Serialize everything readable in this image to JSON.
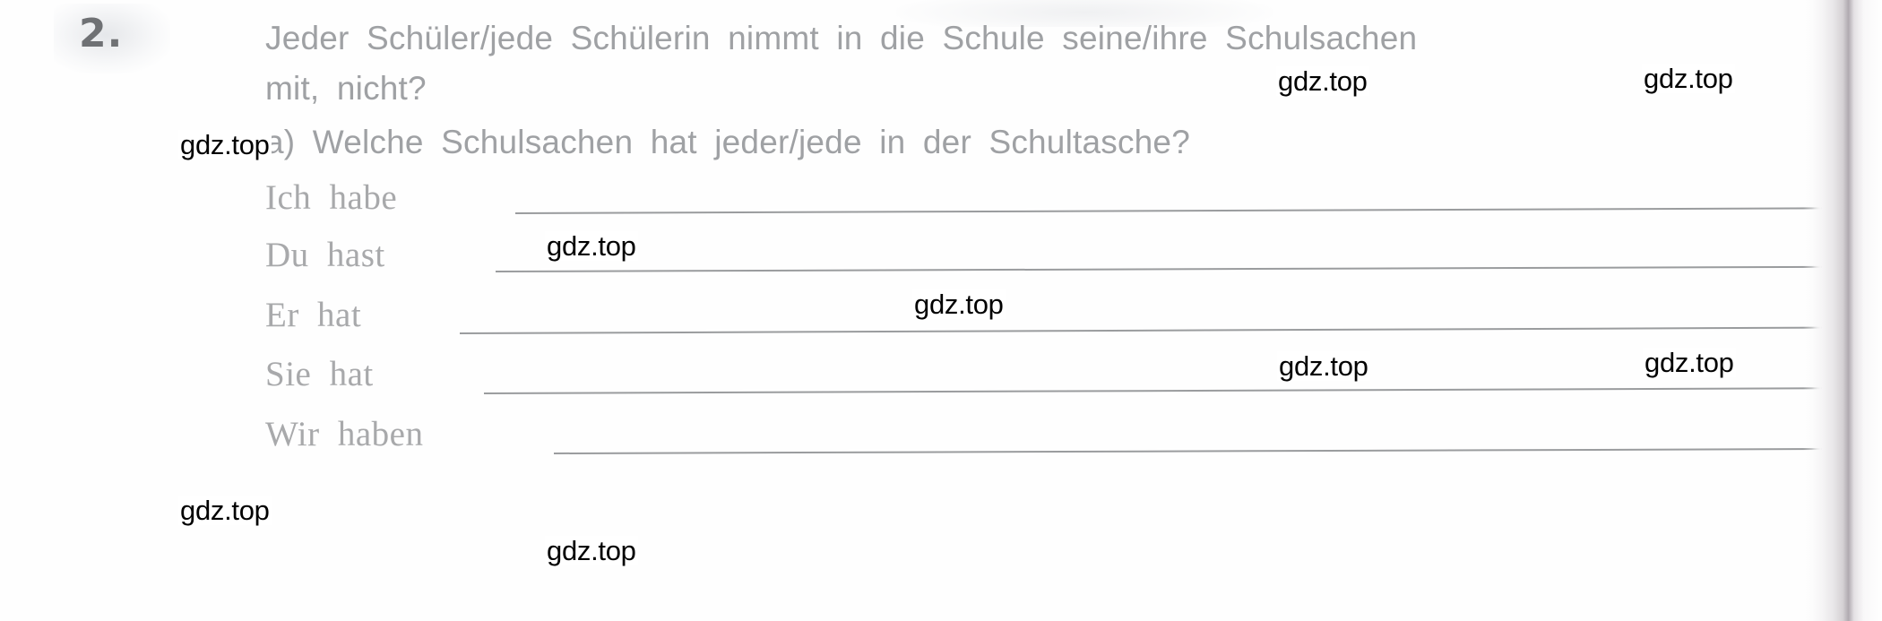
{
  "exercise": {
    "number": "2.",
    "question_line_1": "Jeder Schüler/jede Schülerin nimmt in die Schule seine/ihre Schulsachen",
    "question_line_2": "mit, nicht?",
    "sub_question_a": "a) Welche Schulsachen hat jeder/jede in der Schultasche?"
  },
  "answers": [
    {
      "prompt": "Ich  habe"
    },
    {
      "prompt": "Du  hast"
    },
    {
      "prompt": "Er  hat"
    },
    {
      "prompt": "Sie  hat"
    },
    {
      "prompt": "Wir  haben"
    }
  ],
  "watermarks": [
    {
      "text": "gdz.top"
    },
    {
      "text": "gdz.top"
    },
    {
      "text": "gdz.top"
    },
    {
      "text": "gdz.top"
    },
    {
      "text": "gdz.top"
    },
    {
      "text": "gdz.top"
    },
    {
      "text": "gdz.top"
    },
    {
      "text": "gdz.top"
    },
    {
      "text": "gdz.top"
    }
  ],
  "colors": {
    "page_background": "#fefefe",
    "question_text": "#9fa1a4",
    "prompt_text": "#a8a9ab",
    "exercise_number": "#6f7174",
    "rule_line": "#9a9c9e",
    "watermark": "#000000"
  }
}
